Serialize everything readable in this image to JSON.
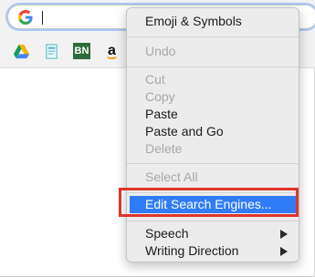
{
  "browser": {
    "omnibox_icon": "google-g-icon",
    "bookmarks": [
      {
        "icon": "google-drive-icon"
      },
      {
        "icon": "teal-note-icon"
      },
      {
        "icon": "barnes-noble-icon",
        "text": "BN"
      },
      {
        "icon": "amazon-icon",
        "text": "a"
      }
    ]
  },
  "context_menu": {
    "items": [
      {
        "label": "Emoji & Symbols",
        "enabled": true
      },
      {
        "label": "Undo",
        "enabled": false
      },
      {
        "label": "Cut",
        "enabled": false
      },
      {
        "label": "Copy",
        "enabled": false
      },
      {
        "label": "Paste",
        "enabled": true
      },
      {
        "label": "Paste and Go",
        "enabled": true
      },
      {
        "label": "Delete",
        "enabled": false
      },
      {
        "label": "Select All",
        "enabled": false
      },
      {
        "label": "Edit Search Engines...",
        "enabled": true,
        "selected": true
      },
      {
        "label": "Speech",
        "enabled": true,
        "submenu": true
      },
      {
        "label": "Writing Direction",
        "enabled": true,
        "submenu": true
      }
    ],
    "selection_color": "#2f7cf6",
    "annotation_color": "#e0352b"
  }
}
